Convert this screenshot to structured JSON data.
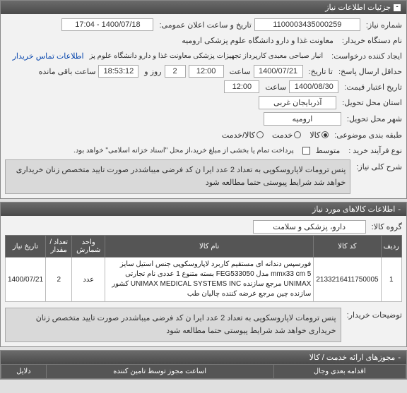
{
  "panel1": {
    "title": "جزئیات اطلاعات نیاز",
    "need_number_lbl": "شماره نیاز:",
    "need_number": "1100003435000259",
    "announce_date_lbl": "تاریخ و ساعت اعلان عمومی:",
    "announce_date": "1400/07/18 - 17:04",
    "buyer_org_lbl": "نام دستگاه خریدار:",
    "buyer_org": "معاونت غذا و دارو دانشگاه علوم پزشکی ارومیه",
    "creator_lbl": "ایجاد کننده درخواست:",
    "creator": "انبار صباحی معبدی کارپرداز تجهیزات پزشکی معاونت غذا و دارو دانشگاه علوم پز",
    "contact_link": "اطلاعات تماس خریدار",
    "deadline_lbl": "حداقل ارسال پاسخ:",
    "to_lbl": "تا تاریخ:",
    "deadline_date": "1400/07/21",
    "time_lbl1": "ساعت",
    "deadline_time": "12:00",
    "days_lbl": "روز و",
    "days": "2",
    "countdown": "18:53:12",
    "remaining_lbl": "ساعت باقی مانده",
    "valid_price_lbl": "تاریخ اعتبار قیمت:",
    "valid_price_date": "1400/08/30",
    "time_lbl2": "ساعت",
    "valid_price_time": "12:00",
    "province_lbl": "استان محل تحویل:",
    "province": "آذربایجان غربی",
    "city_lbl": "شهر محل تحویل:",
    "city": "ارومیه",
    "category_lbl": "طبقه بندی موضوعی:",
    "cat_goods": "کالا",
    "cat_service": "خدمت",
    "cat_both": "کالا/خدمت",
    "buy_process_lbl": "نوع فرآیند خرید :",
    "buy_process": "متوسط",
    "payment_note": "پرداخت تمام یا بخشی از مبلغ خرید،از محل \"اسناد خزانه اسلامی\" خواهد بود."
  },
  "desc": {
    "title_lbl": "شرح کلی نیاز:",
    "text": "پنس ترومات لاپاروسکوپی به تعداد 2 عدد ایرا ن کد فرضی میباشددر صورت تایید متخصص زنان خریداری خواهد شد شرایط پیوستی حتما مطالعه شود"
  },
  "goods_panel": {
    "title": "اطلاعات کالاهای مورد نیاز",
    "group_lbl": "گروه کالا:",
    "group": "دارو، پزشکی و سلامت",
    "cols": [
      "ردیف",
      "کد کالا",
      "نام کالا",
      "واحد شمارش",
      "تعداد / مقدار",
      "تاریخ نیاز"
    ],
    "row": {
      "idx": "1",
      "code": "2133216411750005",
      "name": "فورسپس دندانه ای مستقیم کاربرد لاپاروسکوپی جنس استیل سایز mmx33 cm 5 مدل FEG533050 بسته متنوع 1 عددی نام تجارتی UNIMAX مرجع سازنده UNIMAX MEDICAL SYSTEMS INC کشور سازنده چین مرجع عرضه کننده چالیان طب",
      "unit": "عدد",
      "qty": "2",
      "date": "1400/07/21"
    },
    "buyer_note_lbl": "توضیحات خریدار:",
    "buyer_note": "پنس ترومات لاپاروسکوپی به تعداد 2 عدد ایرا ن کد فرضی میباشددر صورت تایید متخصص زنان خریداری خواهد شد شرایط پیوستی حتما مطالعه شود"
  },
  "perm_panel": {
    "title": "مجوزهای ارائه خدمت / کالا"
  },
  "footer": {
    "col1": "اقدامه بعدی وجال",
    "col2": "اساعت مجوز توسط تامین کننده",
    "col3": "دلایل"
  }
}
